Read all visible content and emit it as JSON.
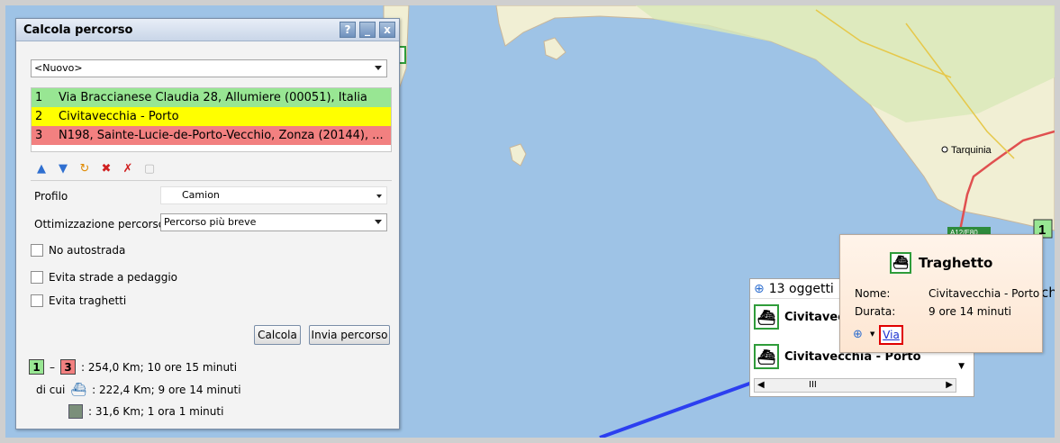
{
  "panel": {
    "title": "Calcola percorso",
    "title_buttons": [
      "?",
      "_",
      "x"
    ],
    "route_select": "<Nuovo>",
    "stops": [
      {
        "n": "1",
        "label": "Via Braccianese Claudia 28, Allumiere (00051), Italia",
        "color": "#98e693"
      },
      {
        "n": "2",
        "label": "Civitavecchia - Porto",
        "color": "#ffff00"
      },
      {
        "n": "3",
        "label": "N198, Sainte-Lucie-de-Porto-Vecchio, Zonza (20144), ...",
        "color": "#f28080"
      }
    ],
    "profile_label": "Profilo",
    "profile_value": "Camion",
    "optimization_label": "Ottimizzazione percorso",
    "optimization_value": "Percorso più breve",
    "options": [
      {
        "label": "No autostrada",
        "checked": false
      },
      {
        "label": "Evita strade a pedaggio",
        "checked": false
      },
      {
        "label": "Evita traghetti",
        "checked": false
      }
    ],
    "calc_button": "Calcola",
    "send_button": "Invia percorso",
    "summary": {
      "from": "1",
      "dash": "–",
      "to": "3",
      "total": ":  254,0 Km; 10 ore 15 minuti",
      "of_which": "di cui",
      "ferry": ":  222,4 Km; 9 ore 14 minuti",
      "road": ":  31,6 Km; 1 ora 1 minuti"
    }
  },
  "map": {
    "city_label": "Tarquinia",
    "marker_number": "1",
    "road_shield": "A12/E80",
    "edge_text": "ch"
  },
  "results": {
    "count_label": "13 oggetti",
    "items": [
      "Civitavecch",
      "Civitavecchia - Porto"
    ],
    "scroll_mark": "III"
  },
  "popup": {
    "title": "Traghetto",
    "name_label": "Nome:",
    "name_value": "Civitavecchia - Porto",
    "duration_label": "Durata:",
    "duration_value": "9 ore 14 minuti",
    "via_link": "Via"
  }
}
